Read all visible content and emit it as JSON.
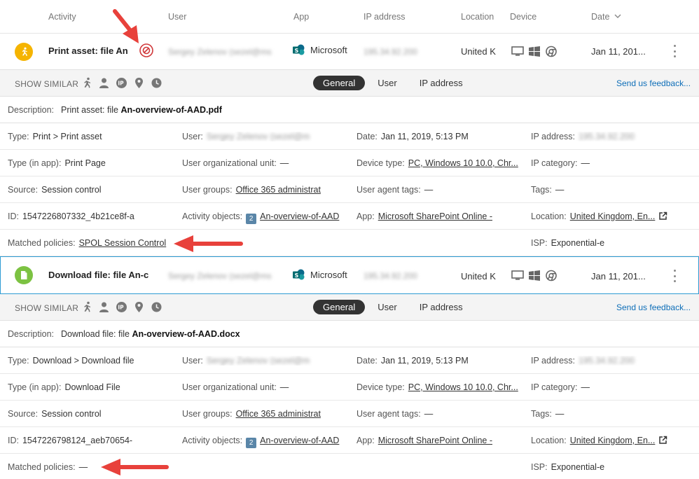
{
  "columns": {
    "activity": "Activity",
    "user": "User",
    "app": "App",
    "ip": "IP address",
    "location": "Location",
    "device": "Device",
    "date": "Date"
  },
  "rows": [
    {
      "title": "Print asset: file An",
      "user": "Sergey Zelenov (sezel@ms",
      "app": "Microsoft",
      "ip": "195.34.92.200",
      "location": "United K",
      "date": "Jan 11, 201...",
      "icon_color": "#f5b400",
      "similar": {
        "label": "SHOW SIMILAR",
        "tabs": [
          "General",
          "User",
          "IP address"
        ],
        "feedback": "Send us feedback..."
      },
      "description": {
        "label": "Description:",
        "prefix": "Print asset: file",
        "file": "An-overview-of-AAD.pdf"
      },
      "fields": {
        "type_label": "Type:",
        "type": "Print > Print asset",
        "user_label": "User:",
        "user": "Sergey Zelenov (sezel@m",
        "date_label": "Date:",
        "date": "Jan 11, 2019, 5:13 PM",
        "ip_label": "IP address:",
        "ip": "195.34.92.200",
        "typeapp_label": "Type (in app):",
        "typeapp": "Print Page",
        "ou_label": "User organizational unit:",
        "ou": "—",
        "devtype_label": "Device type:",
        "devtype": "PC, Windows 10 10.0, Chr...",
        "ipcat_label": "IP category:",
        "ipcat": "—",
        "source_label": "Source:",
        "source": "Session control",
        "groups_label": "User groups:",
        "groups": "Office 365 administrat",
        "agent_label": "User agent tags:",
        "agent": "—",
        "tags_label": "Tags:",
        "tags": "—",
        "id_label": "ID:",
        "id": "1547226807332_4b21ce8f-a",
        "objects_label": "Activity objects:",
        "objects_count": "2",
        "objects": "An-overview-of-AAD",
        "appf_label": "App:",
        "appf": "Microsoft SharePoint Online -",
        "location_label": "Location:",
        "location": "United Kingdom, En...",
        "policies_label": "Matched policies:",
        "policies": "SPOL Session Control",
        "isp_label": "ISP:",
        "isp": "Exponential-e"
      }
    },
    {
      "title": "Download file: file An-c",
      "user": "Sergey Zelenov (sezel@ms",
      "app": "Microsoft",
      "ip": "195.34.92.200",
      "location": "United K",
      "date": "Jan 11, 201...",
      "icon_color": "#7cc242",
      "similar": {
        "label": "SHOW SIMILAR",
        "tabs": [
          "General",
          "User",
          "IP address"
        ],
        "feedback": "Send us feedback..."
      },
      "description": {
        "label": "Description:",
        "prefix": "Download file: file",
        "file": "An-overview-of-AAD.docx"
      },
      "fields": {
        "type_label": "Type:",
        "type": "Download > Download file",
        "user_label": "User:",
        "user": "Sergey Zelenov (sezel@m",
        "date_label": "Date:",
        "date": "Jan 11, 2019, 5:13 PM",
        "ip_label": "IP address:",
        "ip": "195.34.92.200",
        "typeapp_label": "Type (in app):",
        "typeapp": "Download File",
        "ou_label": "User organizational unit:",
        "ou": "—",
        "devtype_label": "Device type:",
        "devtype": "PC, Windows 10 10.0, Chr...",
        "ipcat_label": "IP category:",
        "ipcat": "—",
        "source_label": "Source:",
        "source": "Session control",
        "groups_label": "User groups:",
        "groups": "Office 365 administrat",
        "agent_label": "User agent tags:",
        "agent": "—",
        "tags_label": "Tags:",
        "tags": "—",
        "id_label": "ID:",
        "id": "1547226798124_aeb70654-",
        "objects_label": "Activity objects:",
        "objects_count": "2",
        "objects": "An-overview-of-AAD",
        "appf_label": "App:",
        "appf": "Microsoft SharePoint Online -",
        "location_label": "Location:",
        "location": "United Kingdom, En...",
        "policies_label": "Matched policies:",
        "policies": "—",
        "isp_label": "ISP:",
        "isp": "Exponential-e"
      }
    }
  ],
  "colors": {
    "accent_link": "#0e6eb8",
    "selected_border": "#2d9cd3",
    "arrow": "#e8413b",
    "blocked": "#d0383a"
  }
}
